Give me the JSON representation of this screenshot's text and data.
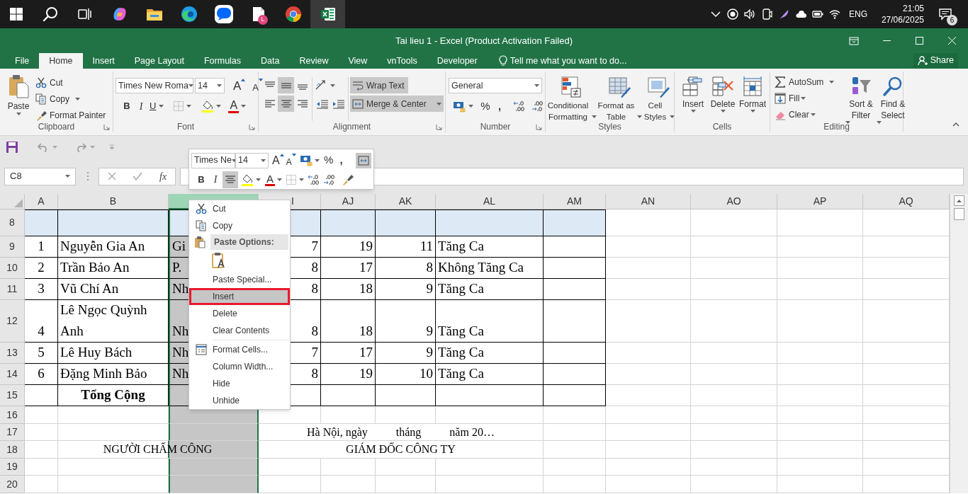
{
  "taskbar": {
    "app_badge": "L",
    "language": "ENG",
    "time": "21:05",
    "date": "27/06/2025",
    "notification_count": "6"
  },
  "window": {
    "title": "Tai lieu 1 - Excel (Product Activation Failed)"
  },
  "tabs": [
    {
      "label": "File",
      "selected": false
    },
    {
      "label": "Home",
      "selected": true
    },
    {
      "label": "Insert",
      "selected": false
    },
    {
      "label": "Page Layout",
      "selected": false
    },
    {
      "label": "Formulas",
      "selected": false
    },
    {
      "label": "Data",
      "selected": false
    },
    {
      "label": "Review",
      "selected": false
    },
    {
      "label": "View",
      "selected": false
    },
    {
      "label": "vnTools",
      "selected": false
    },
    {
      "label": "Developer",
      "selected": false
    }
  ],
  "tell_me": {
    "placeholder": "Tell me what you want to do..."
  },
  "share_button": "Share",
  "ribbon": {
    "clipboard": {
      "label": "Clipboard",
      "paste": "Paste",
      "cut": "Cut",
      "copy": "Copy",
      "format_painter": "Format Painter"
    },
    "font": {
      "label": "Font",
      "font_name": "Times New Roma",
      "font_size": "14",
      "grow": "A",
      "shrink": "A",
      "bold": "B",
      "italic": "I",
      "underline": "U",
      "font_color": "A"
    },
    "alignment": {
      "label": "Alignment",
      "vertical_buttons": [
        {
          "selected": false
        },
        {
          "selected": true
        },
        {
          "selected": false
        }
      ],
      "horizontal_buttons": [
        {
          "selected": false
        },
        {
          "selected": true
        },
        {
          "selected": false
        }
      ],
      "wrap_text": {
        "label": "Wrap Text",
        "on": true
      },
      "merge_center": {
        "label": "Merge & Center",
        "on": true
      }
    },
    "number": {
      "label": "Number",
      "format": "General",
      "percent": "%",
      "comma": ","
    },
    "styles": {
      "label": "Styles",
      "buttons": [
        "Conditional Formatting",
        "Format as Table",
        "Cell Styles"
      ]
    },
    "cells": {
      "label": "Cells",
      "buttons": [
        "Insert",
        "Delete",
        "Format"
      ]
    },
    "editing": {
      "label": "Editing",
      "autosum": "AutoSum",
      "fill": "Fill",
      "clear": "Clear",
      "sort_filter": "Sort & Filter",
      "find_select": "Find & Select"
    }
  },
  "formula_bar": {
    "name_box": "C8",
    "fx": "fx"
  },
  "mini_toolbar": {
    "font_name": "Times Ne",
    "font_size": "14",
    "grow": "A",
    "shrink": "A",
    "percent": "%",
    "comma": ",",
    "bold": "B",
    "italic": "I",
    "font_color": "A",
    "center_aligned": true,
    "merge_on": true
  },
  "sheet": {
    "columns": [
      {
        "label": "A",
        "selected": false,
        "clipped": false
      },
      {
        "label": "B",
        "selected": false,
        "clipped": false
      },
      {
        "selected": true,
        "clipped": false
      },
      {
        "label": "I",
        "selected": false,
        "clipped": true
      },
      {
        "label": "AJ",
        "selected": false,
        "clipped": false
      },
      {
        "label": "AK",
        "selected": false,
        "clipped": false
      },
      {
        "label": "AL",
        "selected": false,
        "clipped": false
      },
      {
        "label": "AM",
        "selected": false,
        "clipped": false
      },
      {
        "label": "AN",
        "selected": false,
        "clipped": false
      },
      {
        "label": "AO",
        "selected": false,
        "clipped": false
      },
      {
        "label": "AP",
        "selected": false,
        "clipped": false
      },
      {
        "label": "AQ",
        "selected": false,
        "clipped": false
      }
    ],
    "rows": [
      {
        "label": "8",
        "kind": "header"
      },
      {
        "label": "9",
        "kind": "data",
        "cells": [
          "1",
          "Nguyễn Gia An",
          "Gi",
          "7",
          "19",
          "11",
          "Tăng Ca"
        ]
      },
      {
        "label": "10",
        "kind": "data",
        "cells": [
          "2",
          "Trần Bảo An",
          "P.",
          "8",
          "17",
          "8",
          "Không Tăng Ca"
        ]
      },
      {
        "label": "11",
        "kind": "data",
        "cells": [
          "3",
          "Vũ Chí An",
          "Nh",
          "8",
          "18",
          "9",
          "Tăng Ca"
        ]
      },
      {
        "label": "12",
        "kind": "data",
        "cells": [
          "4",
          "Lê Ngọc Quỳnh Anh",
          "Nh",
          "8",
          "18",
          "9",
          "Tăng Ca"
        ]
      },
      {
        "label": "13",
        "kind": "data",
        "cells": [
          "5",
          "Lê Huy Bách",
          "Nh",
          "7",
          "17",
          "9",
          "Tăng Ca"
        ]
      },
      {
        "label": "14",
        "kind": "data",
        "cells": [
          "6",
          "Đặng Minh Bảo",
          "Nh",
          "8",
          "19",
          "10",
          "Tăng Ca"
        ]
      },
      {
        "label": "15",
        "kind": "total",
        "cells": [
          null,
          "Tổng Cộng"
        ]
      },
      {
        "label": "16",
        "kind": "plain"
      },
      {
        "label": "17",
        "kind": "plain",
        "caption_right": "Hà Nội, ngày          tháng          năm 20…"
      },
      {
        "label": "18",
        "kind": "plain",
        "caption_left": "NGƯỜI CHẤM CÔNG",
        "caption_right": "GIÁM ĐỐC CÔNG TY"
      },
      {
        "label": "19",
        "kind": "plain"
      },
      {
        "label": "20",
        "kind": "plain"
      }
    ]
  },
  "context_menu": {
    "items": [
      {
        "kind": "item",
        "label": "Cut",
        "selected": false
      },
      {
        "kind": "item",
        "label": "Copy",
        "selected": false
      },
      {
        "kind": "heading",
        "label": "Paste Options:"
      },
      {
        "kind": "paste_icons"
      },
      {
        "kind": "item",
        "label": "Paste Special...",
        "selected": false
      },
      {
        "kind": "item",
        "label": "Insert",
        "selected": true
      },
      {
        "kind": "item",
        "label": "Delete",
        "selected": false
      },
      {
        "kind": "item",
        "label": "Clear Contents",
        "selected": false
      },
      {
        "kind": "separator"
      },
      {
        "kind": "item",
        "label": "Format Cells...",
        "selected": false
      },
      {
        "kind": "item",
        "label": "Column Width...",
        "selected": false
      },
      {
        "kind": "item",
        "label": "Hide",
        "selected": false
      },
      {
        "kind": "item",
        "label": "Unhide",
        "selected": false
      }
    ]
  }
}
